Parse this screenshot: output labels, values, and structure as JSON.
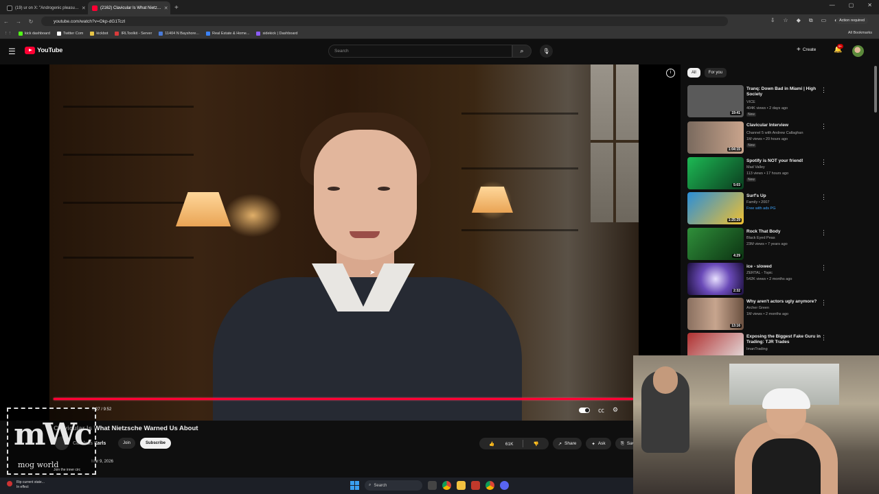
{
  "browser": {
    "tabs": [
      {
        "label": "(19) ur on X: \"Androgenic pleasu…",
        "active": false,
        "favicon_color": "#111111"
      },
      {
        "label": "(2162) Clavicular Is What Nietz…",
        "active": true,
        "favicon_color": "#ff0033"
      }
    ],
    "url": "youtube.com/watch?v=Okp-dG1Tczl",
    "action_required": "Action required",
    "bookmarks": [
      {
        "label": "kick dashboard",
        "color": "#53fc18"
      },
      {
        "label": "Twitter Com",
        "color": "#ffffff"
      },
      {
        "label": "kickbot",
        "color": "#e8c547"
      },
      {
        "label": "IRLToolkit - Server",
        "color": "#d93b3b"
      },
      {
        "label": "11404 N Bayshore...",
        "color": "#4a7bd8"
      },
      {
        "label": "Real Estate & Home...",
        "color": "#3b82f6"
      },
      {
        "label": "sidekick | Dashboard",
        "color": "#8b5cf6"
      }
    ],
    "all_bookmarks": "All Bookmarks"
  },
  "header": {
    "logo_text": "YouTube",
    "search_placeholder": "Search",
    "create_label": "Create",
    "notif_count": "9+"
  },
  "player": {
    "progress_fraction": 1.0,
    "time": "0:27 / 9:52"
  },
  "video": {
    "title": "Clavicular Is What Nietzsche Warned Us About",
    "channel": "Careless Earls",
    "subscribers": "",
    "join_label": "Join",
    "subscribe_label": "Subscribe",
    "likes": "61K",
    "share_label": "Share",
    "ask_label": "Ask",
    "save_label": "Save",
    "meta": "Mar 9, 2026",
    "watermark_join": "Join the inner circ"
  },
  "overlay": {
    "big": "mWc",
    "small": "mog world"
  },
  "recommendations": {
    "chips": [
      "All",
      "For you"
    ],
    "items": [
      {
        "title": "Tranq: Down Bad in Miami | High Society",
        "channel": "VICE",
        "meta": "404K views • 2 days ago",
        "badge": "New",
        "duration": "19:41",
        "thumb": "#5a5a5a"
      },
      {
        "title": "Clavicular Interview",
        "channel": "Channel 5 with Andrew Callaghan",
        "meta": "1M views • 20 hours ago",
        "badge": "New",
        "duration": "1:04:15",
        "thumb": "#7a6a5e"
      },
      {
        "title": "Spotify is NOT your friend!",
        "channel": "Mad Valley",
        "meta": "113 views • 17 hours ago",
        "badge": "New",
        "duration": "5:03",
        "thumb": "#1db954"
      },
      {
        "title": "Surf's Up",
        "channel": "Family • 2007",
        "meta": "Free with ads  PG",
        "badge": "",
        "duration": "1:25:29",
        "thumb": "#2a8ed8"
      },
      {
        "title": "Rock That Body",
        "channel": "Black Eyed Peas",
        "meta": "23M views • 7 years ago",
        "badge": "",
        "duration": "4:29",
        "thumb": "#2f8f3a"
      },
      {
        "title": "ice - slowed",
        "channel": "ZERTAL - Topic",
        "meta": "542K views • 2 months ago",
        "badge": "",
        "duration": "2:32",
        "thumb": "#6a4ab8"
      },
      {
        "title": "Why aren't actors ugly anymore?",
        "channel": "Archer Green",
        "meta": "1M views • 2 months ago",
        "badge": "",
        "duration": "13:16",
        "thumb": "#8a7060"
      },
      {
        "title": "Exposing the Biggest Fake Guru in Trading: TJR Trades",
        "channel": "ImanTrading",
        "meta": "",
        "badge": "",
        "duration": "",
        "thumb": "#b03030"
      }
    ]
  },
  "taskbar": {
    "weather_line1": "Rip current state...",
    "weather_line2": "In effect",
    "search_label": "Search"
  }
}
